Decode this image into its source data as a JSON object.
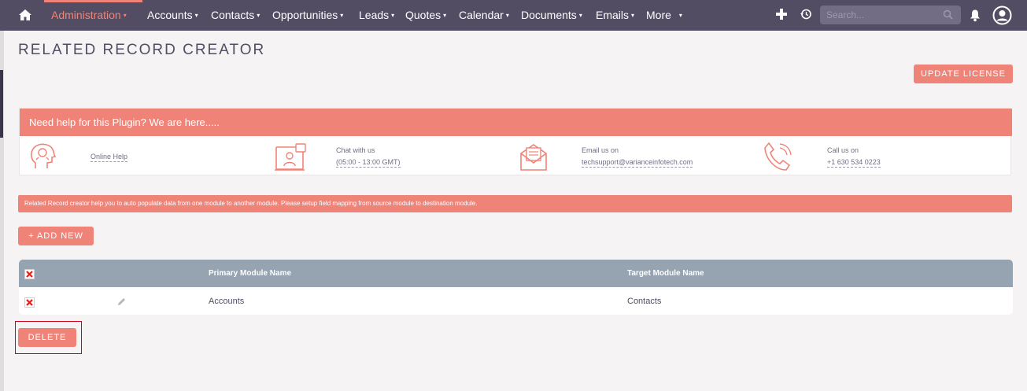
{
  "nav": {
    "items": [
      {
        "label": "Administration",
        "active": true
      },
      {
        "label": "Accounts"
      },
      {
        "label": "Contacts"
      },
      {
        "label": "Opportunities"
      },
      {
        "label": "Leads"
      },
      {
        "label": "Quotes"
      },
      {
        "label": "Calendar"
      },
      {
        "label": "Documents"
      },
      {
        "label": "Emails"
      },
      {
        "label": "More"
      }
    ],
    "caret": "▾",
    "search_placeholder": "Search...",
    "icons": [
      "home-icon",
      "plus-icon",
      "history-icon",
      "search-icon",
      "bell-icon",
      "user-icon"
    ]
  },
  "page": {
    "title": "RELATED RECORD CREATOR",
    "update_license": "UPDATE LICENSE"
  },
  "help": {
    "heading": "Need help for this Plugin? We are here.....",
    "online_help": "Online Help",
    "chat_label": "Chat with us",
    "chat_hours": "(05:00 - 13:00 GMT)",
    "email_label": "Email us on",
    "email": "techsupport@varianceinfotech.com",
    "call_label": "Call us on",
    "phone": "+1 630 534 0223"
  },
  "info": "Related Record creator help you to auto populate data from one module to another module. Please setup field mapping from source module to destination module.",
  "add_new": "+ ADD NEW",
  "table": {
    "headers": {
      "primary": "Primary Module Name",
      "target": "Target Module Name"
    },
    "rows": [
      {
        "primary": "Accounts",
        "target": "Contacts"
      }
    ]
  },
  "delete": "DELETE",
  "colors": {
    "accent": "#f08377",
    "nav_bg": "#534d64",
    "table_head": "#96a3b0",
    "highlight": "#d0021b"
  }
}
